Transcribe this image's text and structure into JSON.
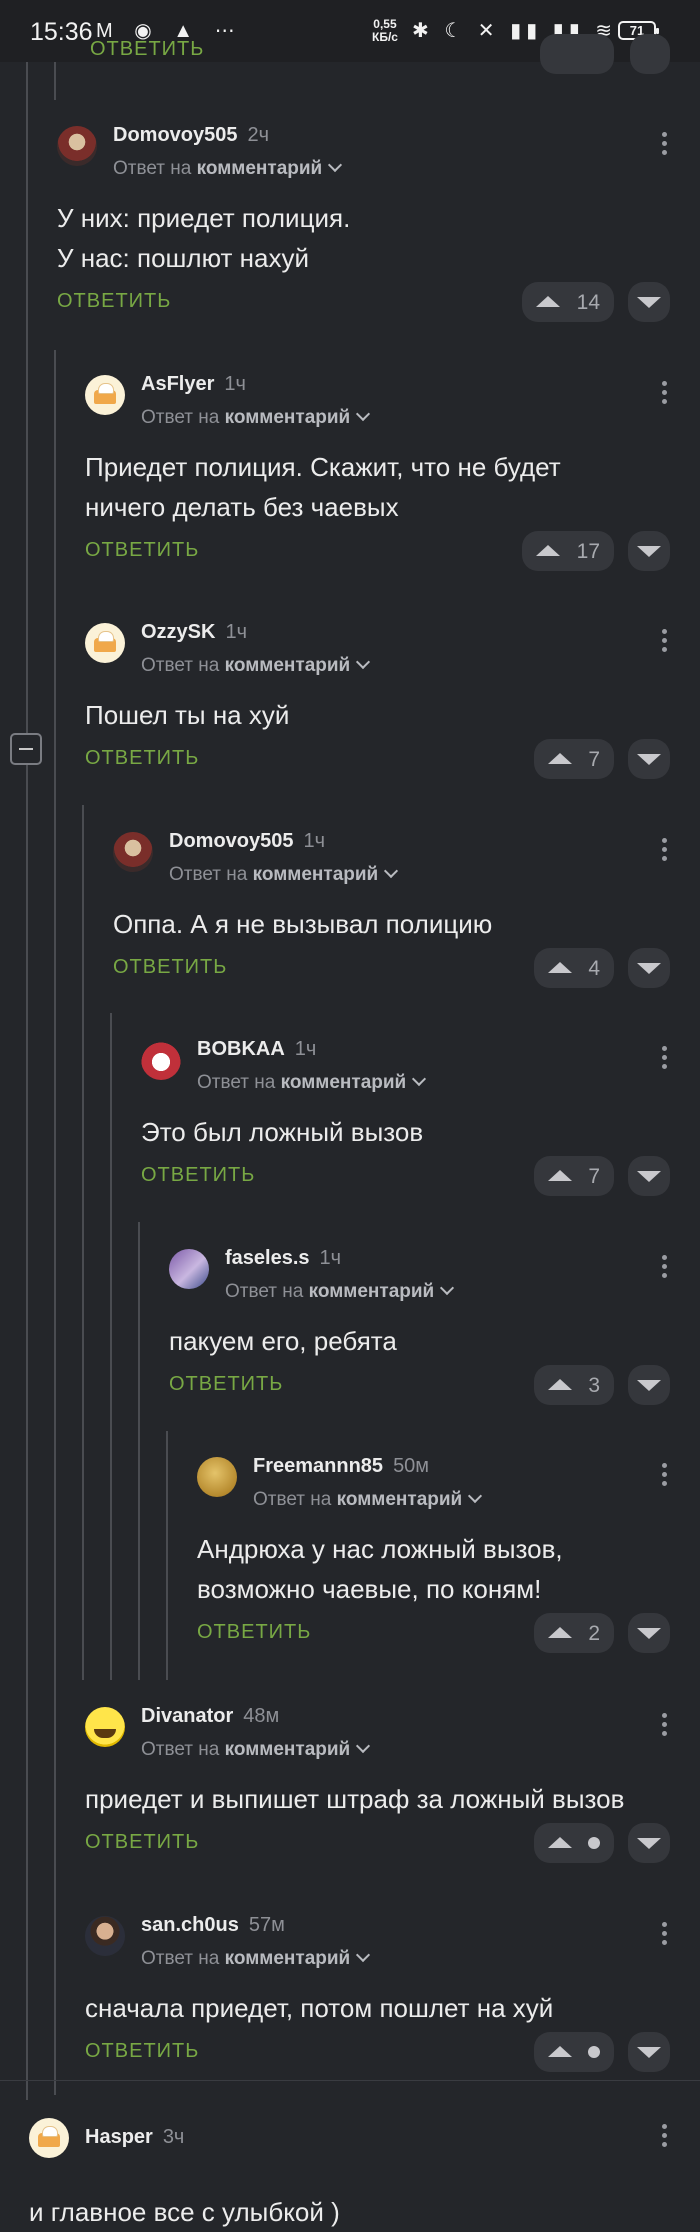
{
  "status_bar": {
    "time": "15:36",
    "left_icons": "M ◉ ▲ ⋯",
    "speed_value": "0,55",
    "speed_unit": "КБ/с",
    "right_icons": "✱ ☾ ✕ ▮▮ ▮▮ ≋",
    "battery": "71"
  },
  "partial_row": {
    "reply_label": "ОТВЕТИТЬ"
  },
  "reply_prefix": "Ответ на",
  "reply_target": "комментарий",
  "reply_label": "ОТВЕТИТЬ",
  "comments": [
    {
      "author": "Domovoy505",
      "time": "2ч",
      "lines": [
        "У них: приедет полиция.",
        "У нас: пошлют нахуй"
      ],
      "rating": "14"
    },
    {
      "author": "AsFlyer",
      "time": "1ч",
      "lines": [
        "Приедет полиция. Скажит, что не будет",
        "ничего делать без чаевых"
      ],
      "rating": "17"
    },
    {
      "author": "OzzySK",
      "time": "1ч",
      "lines": [
        "Пошел ты на хуй"
      ],
      "rating": "7"
    },
    {
      "author": "Domovoy505",
      "time": "1ч",
      "lines": [
        "Оппа. А я не вызывал полицию"
      ],
      "rating": "4"
    },
    {
      "author": "BOBKAA",
      "time": "1ч",
      "lines": [
        "Это был ложный вызов"
      ],
      "rating": "7"
    },
    {
      "author": "faseles.s",
      "time": "1ч",
      "lines": [
        "пакуем его, ребята"
      ],
      "rating": "3"
    },
    {
      "author": "Freemannn85",
      "time": "50м",
      "lines": [
        "Андрюха у нас ложный вызов,",
        "возможно чаевые, по коням!"
      ],
      "rating": "2"
    },
    {
      "author": "Divanator",
      "time": "48м",
      "lines": [
        "приедет и выпишет штраф за ложный вызов"
      ],
      "rating": ""
    },
    {
      "author": "san.ch0us",
      "time": "57м",
      "lines": [
        "сначала приедет, потом пошлет на хуй"
      ],
      "rating": ""
    },
    {
      "author": "Hasper",
      "time": "3ч",
      "lines": [
        "и главное все с улыбкой )"
      ]
    }
  ]
}
